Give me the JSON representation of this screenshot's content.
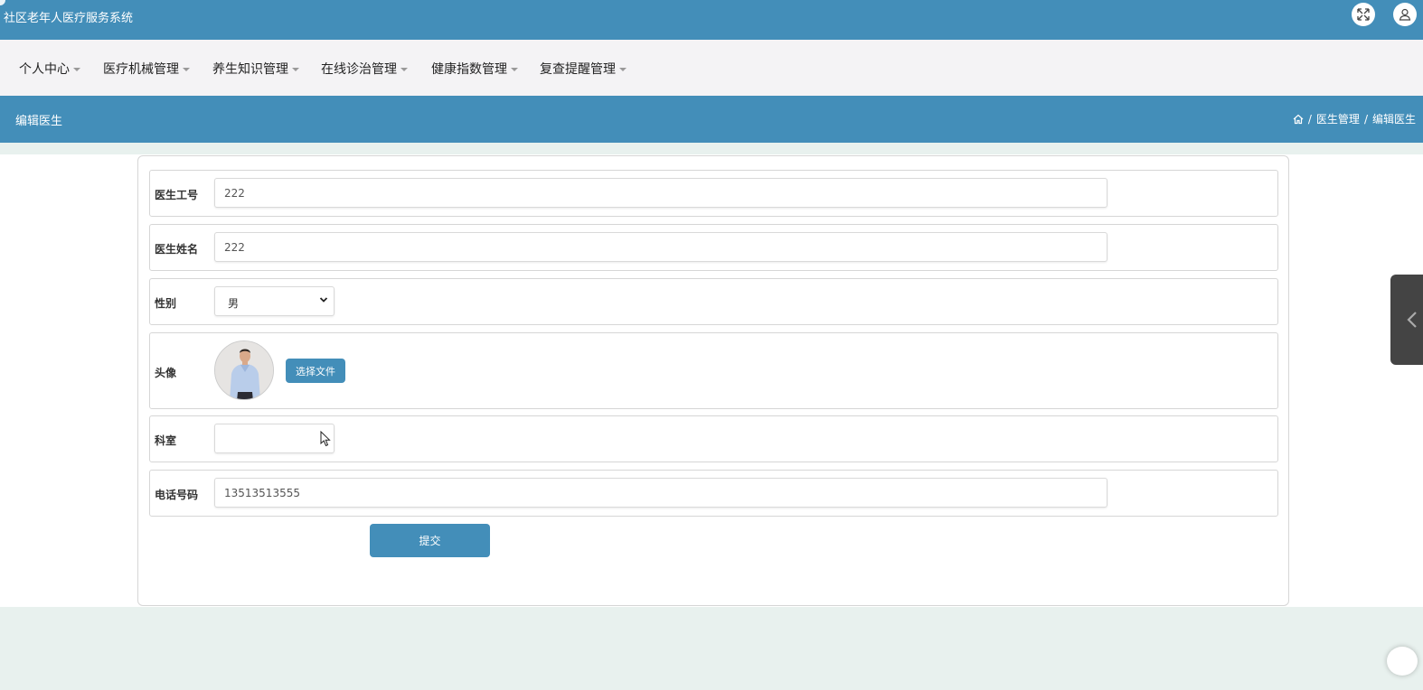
{
  "app": {
    "title": "社区老年人医疗服务系统"
  },
  "nav": {
    "items": [
      {
        "label": "个人中心"
      },
      {
        "label": "医疗机械管理"
      },
      {
        "label": "养生知识管理"
      },
      {
        "label": "在线诊治管理"
      },
      {
        "label": "健康指数管理"
      },
      {
        "label": "复查提醒管理"
      }
    ]
  },
  "header": {
    "page_title": "编辑医生",
    "breadcrumb": {
      "sep": "/",
      "parent": "医生管理",
      "current": "编辑医生"
    }
  },
  "form": {
    "doctor_id": {
      "label": "医生工号",
      "value": "222"
    },
    "doctor_name": {
      "label": "医生姓名",
      "value": "222"
    },
    "gender": {
      "label": "性别",
      "value": "男"
    },
    "avatar": {
      "label": "头像",
      "button_label": "选择文件"
    },
    "department": {
      "label": "科室",
      "value": ""
    },
    "phone": {
      "label": "电话号码",
      "value": "13513513555"
    },
    "submit_label": "提交"
  },
  "colors": {
    "primary": "#438eb9",
    "page_bg": "#e8f1ee",
    "nav_bg": "#f4f3f5"
  },
  "icons": {
    "fullscreen": "expand-arrows-icon",
    "user": "user-icon",
    "home": "home-icon",
    "select": "chevron-down-icon",
    "side_tab": "chevron-left-icon"
  }
}
